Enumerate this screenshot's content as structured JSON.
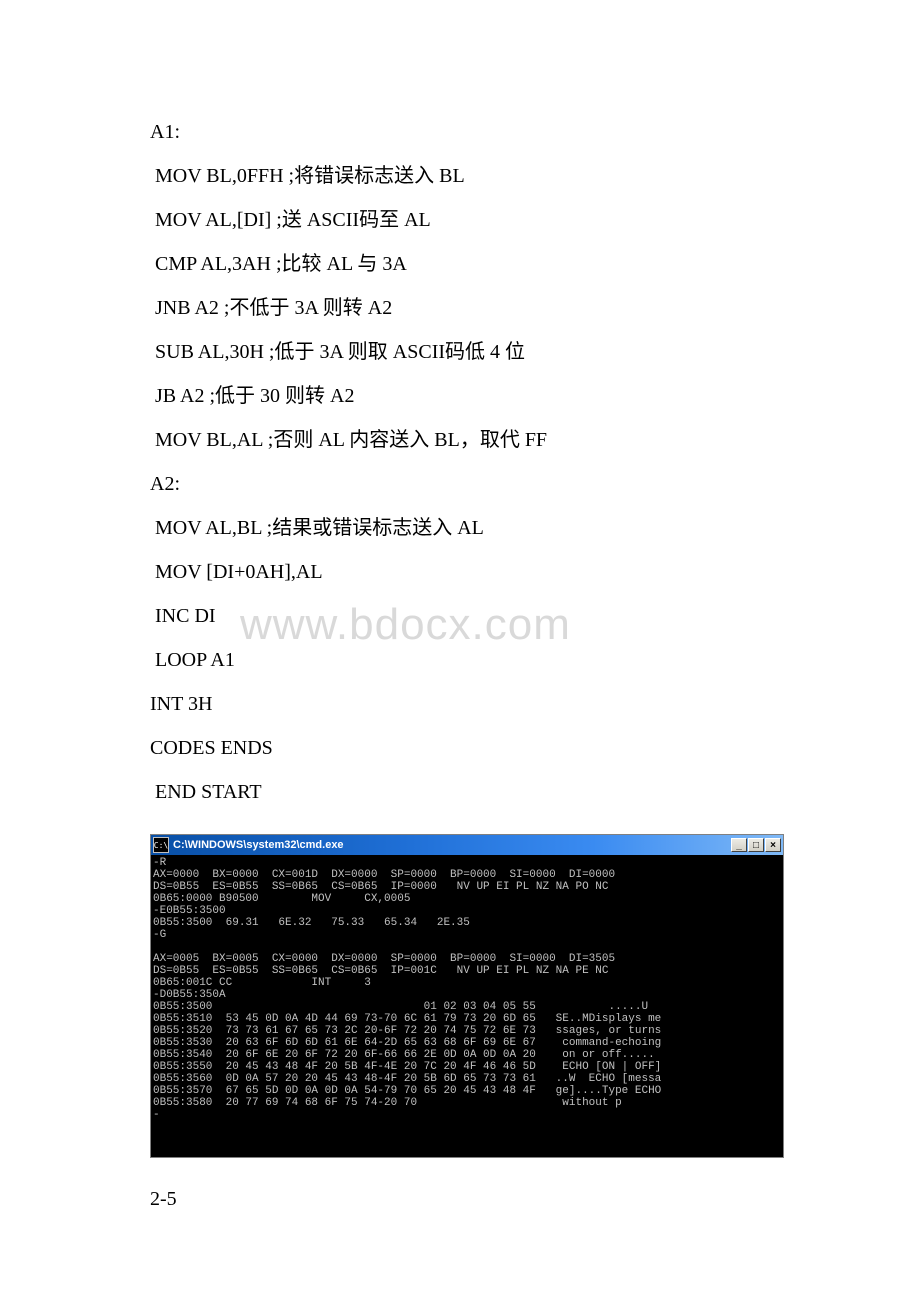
{
  "code": {
    "l0": "A1:",
    "l1": " MOV BL,0FFH ;将错误标志送入 BL",
    "l2": " MOV AL,[DI] ;送 ASCII码至 AL",
    "l3": " CMP AL,3AH ;比较 AL 与 3A",
    "l4": " JNB A2 ;不低于 3A 则转 A2",
    "l5": " SUB AL,30H ;低于 3A 则取 ASCII码低 4 位",
    "l6": " JB A2 ;低于 30 则转 A2",
    "l7": " MOV BL,AL ;否则 AL 内容送入 BL，取代 FF",
    "l8": "A2:",
    "l9": " MOV AL,BL ;结果或错误标志送入 AL",
    "l10": " MOV [DI+0AH],AL",
    "l11": " INC DI",
    "l12": " LOOP A1",
    "l13": "INT 3H",
    "l14": "CODES ENDS",
    "l15": " END START"
  },
  "watermark": "www.bdocx.com",
  "cmd": {
    "icon_text": "C:\\",
    "title": "C:\\WINDOWS\\system32\\cmd.exe",
    "min": "_",
    "max": "□",
    "close": "×",
    "lines": [
      "-R",
      "AX=0000  BX=0000  CX=001D  DX=0000  SP=0000  BP=0000  SI=0000  DI=0000",
      "DS=0B55  ES=0B55  SS=0B65  CS=0B65  IP=0000   NV UP EI PL NZ NA PO NC",
      "0B65:0000 B90500        MOV     CX,0005",
      "-E0B55:3500",
      "0B55:3500  69.31   6E.32   75.33   65.34   2E.35",
      "-G",
      "",
      "AX=0005  BX=0005  CX=0000  DX=0000  SP=0000  BP=0000  SI=0000  DI=3505",
      "DS=0B55  ES=0B55  SS=0B65  CS=0B65  IP=001C   NV UP EI PL NZ NA PE NC",
      "0B65:001C CC            INT     3",
      "-D0B55:350A",
      "0B55:3500                                01 02 03 04 05 55           .....U",
      "0B55:3510  53 45 0D 0A 4D 44 69 73-70 6C 61 79 73 20 6D 65   SE..MDisplays me",
      "0B55:3520  73 73 61 67 65 73 2C 20-6F 72 20 74 75 72 6E 73   ssages, or turns",
      "0B55:3530  20 63 6F 6D 6D 61 6E 64-2D 65 63 68 6F 69 6E 67    command-echoing",
      "0B55:3540  20 6F 6E 20 6F 72 20 6F-66 66 2E 0D 0A 0D 0A 20    on or off..... ",
      "0B55:3550  20 45 43 48 4F 20 5B 4F-4E 20 7C 20 4F 46 46 5D    ECHO [ON | OFF]",
      "0B55:3560  0D 0A 57 20 20 45 43 48-4F 20 5B 6D 65 73 73 61   ..W  ECHO [messa",
      "0B55:3570  67 65 5D 0D 0A 0D 0A 54-79 70 65 20 45 43 48 4F   ge]....Type ECHO",
      "0B55:3580  20 77 69 74 68 6F 75 74-20 70                      without p",
      "-"
    ]
  },
  "footer": "2-5"
}
